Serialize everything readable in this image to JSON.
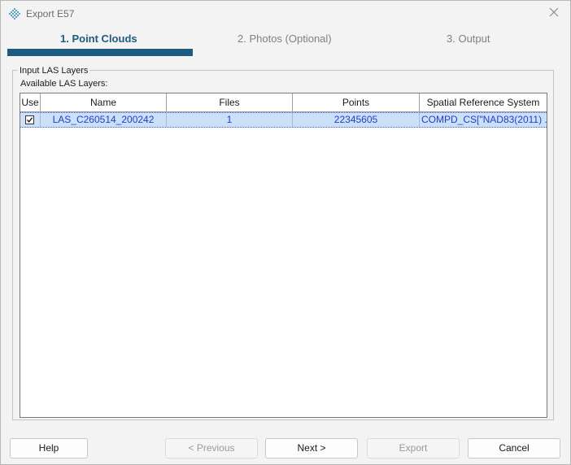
{
  "window": {
    "title": "Export E57",
    "app_icon": "e57-diamond-icon",
    "close_icon": "close-icon"
  },
  "steps": [
    {
      "label": "1.  Point Clouds",
      "active": true
    },
    {
      "label": "2.  Photos (Optional)",
      "active": false
    },
    {
      "label": "3.  Output",
      "active": false
    }
  ],
  "layers_group": {
    "legend": "Input LAS Layers",
    "available_label": "Available LAS Layers:"
  },
  "table": {
    "columns": [
      "Use",
      "Name",
      "Files",
      "Points",
      "Spatial Reference System"
    ],
    "rows": [
      {
        "use_checked": true,
        "name": "LAS_C260514_200242",
        "files": "1",
        "points": "22345605",
        "srs": "COMPD_CS[\"NAD83(2011) ..."
      }
    ]
  },
  "buttons": {
    "help": "Help",
    "previous": "< Previous",
    "next": "Next >",
    "export": "Export",
    "cancel": "Cancel"
  },
  "colors": {
    "accent": "#1d5b80",
    "selection": "#cce0fa",
    "selection_text": "#1e3fc8"
  }
}
